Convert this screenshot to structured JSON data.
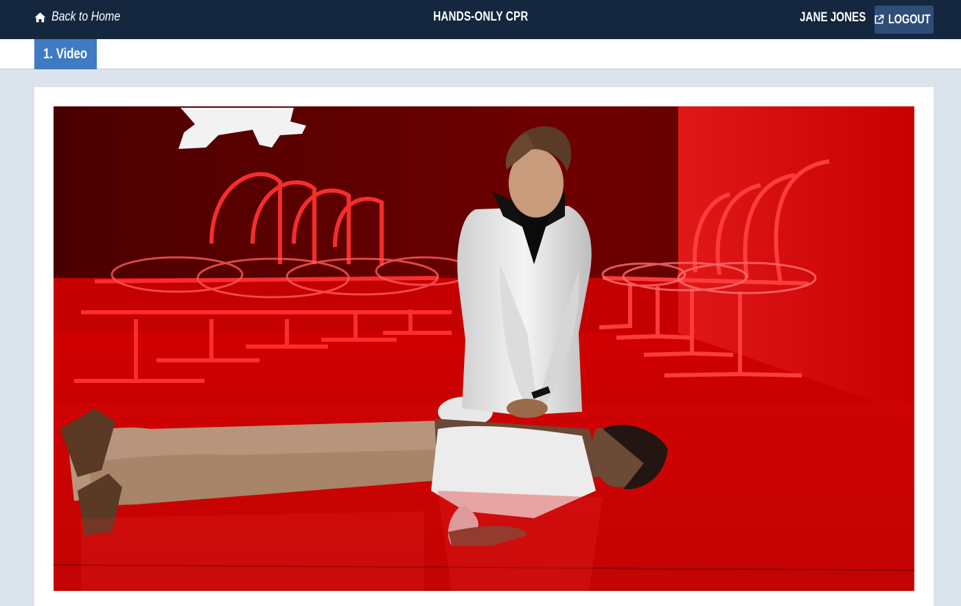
{
  "header": {
    "back_label": "Back to Home",
    "title": "HANDS-ONLY CPR",
    "user_name": "JANE JONES",
    "logout_label": "LOGOUT"
  },
  "tabs": [
    {
      "label": "1. Video",
      "active": true
    }
  ],
  "colors": {
    "topbar": "#14273f",
    "tab_active": "#3f7bc3",
    "logout_button": "#2e4e78",
    "page_background": "#dbe4ec"
  },
  "icons": {
    "back": "home-icon",
    "logout": "external-link-icon"
  }
}
